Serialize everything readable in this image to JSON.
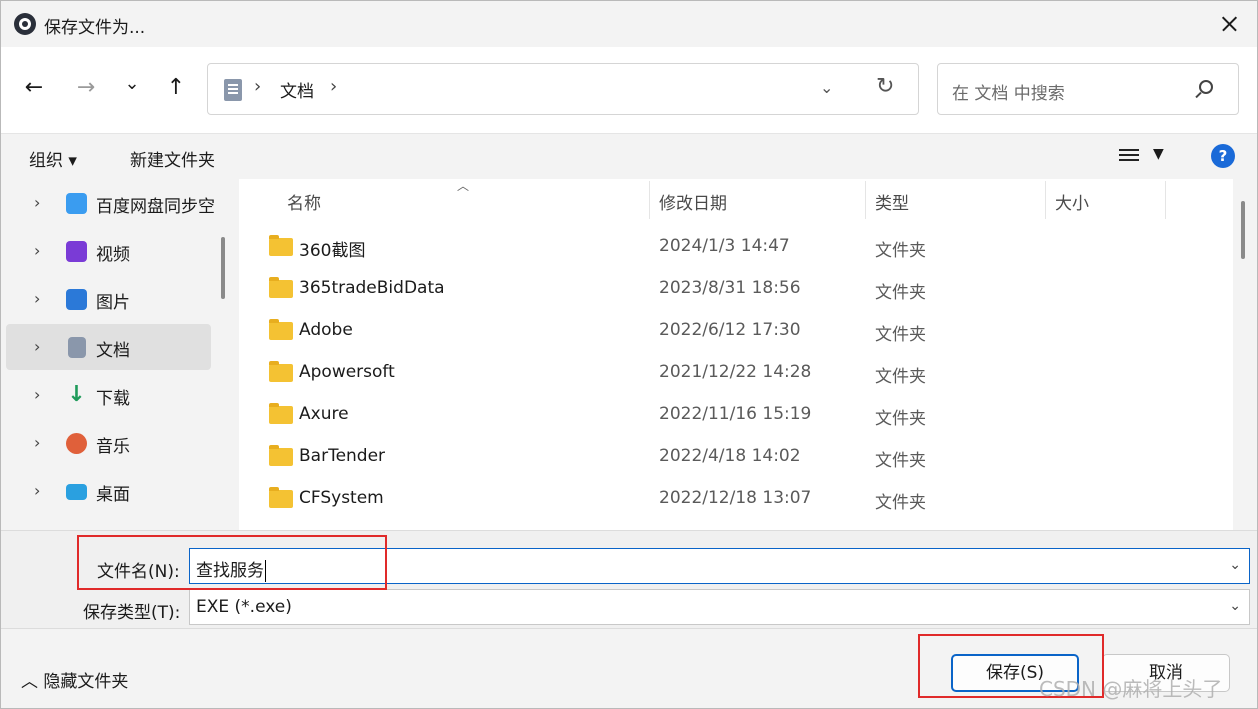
{
  "window": {
    "title": "保存文件为..."
  },
  "nav": {
    "back": "←",
    "forward": "→",
    "recent": "⌄",
    "up": "↑",
    "path": [
      "文档"
    ],
    "search_placeholder": "在 文档 中搜索"
  },
  "toolbar": {
    "organize": "组织 ▾",
    "new_folder": "新建文件夹",
    "help": "?"
  },
  "sidebar": {
    "items": [
      {
        "label": "百度网盘同步空",
        "icon": "baidu-netdisk-icon",
        "color": "#3a9cf0"
      },
      {
        "label": "视频",
        "icon": "video-icon",
        "color": "#7a3bd6"
      },
      {
        "label": "图片",
        "icon": "pictures-icon",
        "color": "#2b79d8"
      },
      {
        "label": "文档",
        "icon": "documents-icon",
        "color": "#8a97ab",
        "selected": true
      },
      {
        "label": "下载",
        "icon": "download-icon",
        "color": "#1f9a5a"
      },
      {
        "label": "音乐",
        "icon": "music-icon",
        "color": "#e0603a"
      },
      {
        "label": "桌面",
        "icon": "desktop-icon",
        "color": "#2aa0e0"
      }
    ]
  },
  "columns": {
    "name": "名称",
    "date": "修改日期",
    "type": "类型",
    "size": "大小"
  },
  "files": [
    {
      "name": "360截图",
      "date": "2024/1/3 14:47",
      "type": "文件夹"
    },
    {
      "name": "365tradeBidData",
      "date": "2023/8/31 18:56",
      "type": "文件夹"
    },
    {
      "name": "Adobe",
      "date": "2022/6/12 17:30",
      "type": "文件夹"
    },
    {
      "name": "Apowersoft",
      "date": "2021/12/22 14:28",
      "type": "文件夹"
    },
    {
      "name": "Axure",
      "date": "2022/11/16 15:19",
      "type": "文件夹"
    },
    {
      "name": "BarTender",
      "date": "2022/4/18 14:02",
      "type": "文件夹"
    },
    {
      "name": "CFSystem",
      "date": "2022/12/18 13:07",
      "type": "文件夹"
    }
  ],
  "form": {
    "filename_label": "文件名(N):",
    "filename_value": "查找服务",
    "filetype_label": "保存类型(T):",
    "filetype_value": "EXE (*.exe)"
  },
  "footer": {
    "hide_folders": "隐藏文件夹",
    "save": "保存(S)",
    "cancel": "取消"
  },
  "watermark": "CSDN @麻将上头了",
  "colors": {
    "accent": "#0a64c8",
    "annotation": "#e02a2a",
    "folder": "#f4c233"
  }
}
